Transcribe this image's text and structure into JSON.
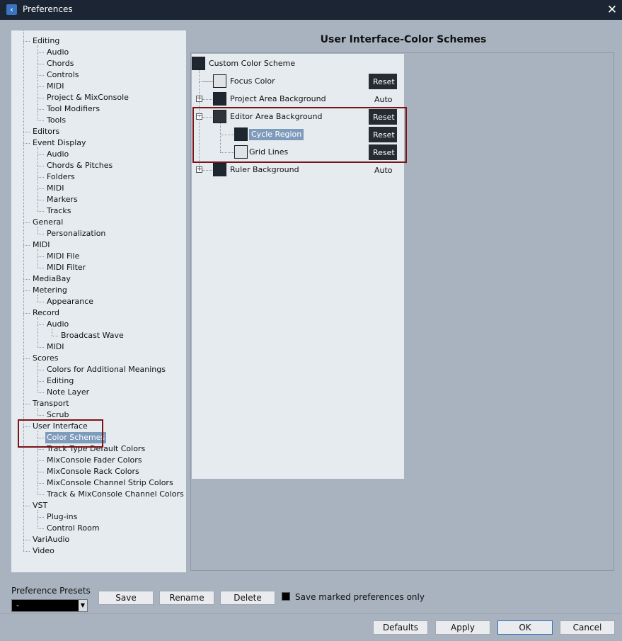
{
  "window": {
    "title": "Preferences"
  },
  "nav": {
    "items": [
      {
        "label": "Editing",
        "level": 0
      },
      {
        "label": "Audio",
        "level": 1
      },
      {
        "label": "Chords",
        "level": 1
      },
      {
        "label": "Controls",
        "level": 1
      },
      {
        "label": "MIDI",
        "level": 1
      },
      {
        "label": "Project & MixConsole",
        "level": 1
      },
      {
        "label": "Tool Modifiers",
        "level": 1
      },
      {
        "label": "Tools",
        "level": 1
      },
      {
        "label": "Editors",
        "level": 0
      },
      {
        "label": "Event Display",
        "level": 0
      },
      {
        "label": "Audio",
        "level": 1
      },
      {
        "label": "Chords & Pitches",
        "level": 1
      },
      {
        "label": "Folders",
        "level": 1
      },
      {
        "label": "MIDI",
        "level": 1
      },
      {
        "label": "Markers",
        "level": 1
      },
      {
        "label": "Tracks",
        "level": 1
      },
      {
        "label": "General",
        "level": 0
      },
      {
        "label": "Personalization",
        "level": 1
      },
      {
        "label": "MIDI",
        "level": 0
      },
      {
        "label": "MIDI File",
        "level": 1
      },
      {
        "label": "MIDI Filter",
        "level": 1
      },
      {
        "label": "MediaBay",
        "level": 0
      },
      {
        "label": "Metering",
        "level": 0
      },
      {
        "label": "Appearance",
        "level": 1
      },
      {
        "label": "Record",
        "level": 0
      },
      {
        "label": "Audio",
        "level": 1
      },
      {
        "label": "Broadcast Wave",
        "level": 2
      },
      {
        "label": "MIDI",
        "level": 1
      },
      {
        "label": "Scores",
        "level": 0
      },
      {
        "label": "Colors for Additional Meanings",
        "level": 1
      },
      {
        "label": "Editing",
        "level": 1
      },
      {
        "label": "Note Layer",
        "level": 1
      },
      {
        "label": "Transport",
        "level": 0
      },
      {
        "label": "Scrub",
        "level": 1
      },
      {
        "label": "User Interface",
        "level": 0
      },
      {
        "label": "Color Schemes",
        "level": 1,
        "selected": true
      },
      {
        "label": "Track Type Default Colors",
        "level": 1
      },
      {
        "label": "MixConsole Fader Colors",
        "level": 1
      },
      {
        "label": "MixConsole Rack Colors",
        "level": 1
      },
      {
        "label": "MixConsole Channel Strip Colors",
        "level": 1
      },
      {
        "label": "Track & MixConsole Channel Colors",
        "level": 1
      },
      {
        "label": "VST",
        "level": 0
      },
      {
        "label": "Plug-ins",
        "level": 1
      },
      {
        "label": "Control Room",
        "level": 1
      },
      {
        "label": "VariAudio",
        "level": 0
      },
      {
        "label": "Video",
        "level": 0
      }
    ]
  },
  "panel": {
    "heading": "User Interface-Color Schemes",
    "rows": [
      {
        "label": "Custom Color Scheme",
        "level": 0,
        "swatch": "#1e2630",
        "action": null
      },
      {
        "label": "Focus Color",
        "level": 1,
        "swatch": "#dfe3e8",
        "action": "Reset"
      },
      {
        "label": "Project Area Background",
        "level": 1,
        "swatch": "#1e2630",
        "action": "Auto",
        "expander": "+"
      },
      {
        "label": "Editor Area Background",
        "level": 1,
        "swatch": "#2e3538",
        "action": "Reset",
        "expander": "−"
      },
      {
        "label": "Cycle Region",
        "level": 2,
        "swatch": "#1e2630",
        "action": "Reset",
        "selected": true
      },
      {
        "label": "Grid Lines",
        "level": 2,
        "swatch": "#dfe3e8",
        "action": "Reset"
      },
      {
        "label": "Ruler Background",
        "level": 1,
        "swatch": "#1e2630",
        "action": "Auto",
        "expander": "+"
      }
    ]
  },
  "footer": {
    "presets_label": "Preference Presets",
    "preset_value": "-",
    "save": "Save",
    "rename": "Rename",
    "delete": "Delete",
    "save_marked": "Save marked preferences only",
    "defaults": "Defaults",
    "apply": "Apply",
    "ok": "OK",
    "cancel": "Cancel"
  },
  "colors": {
    "accent_selection": "#7f9bbb",
    "highlight_box": "#7a1416",
    "titlebar": "#1b2533"
  }
}
